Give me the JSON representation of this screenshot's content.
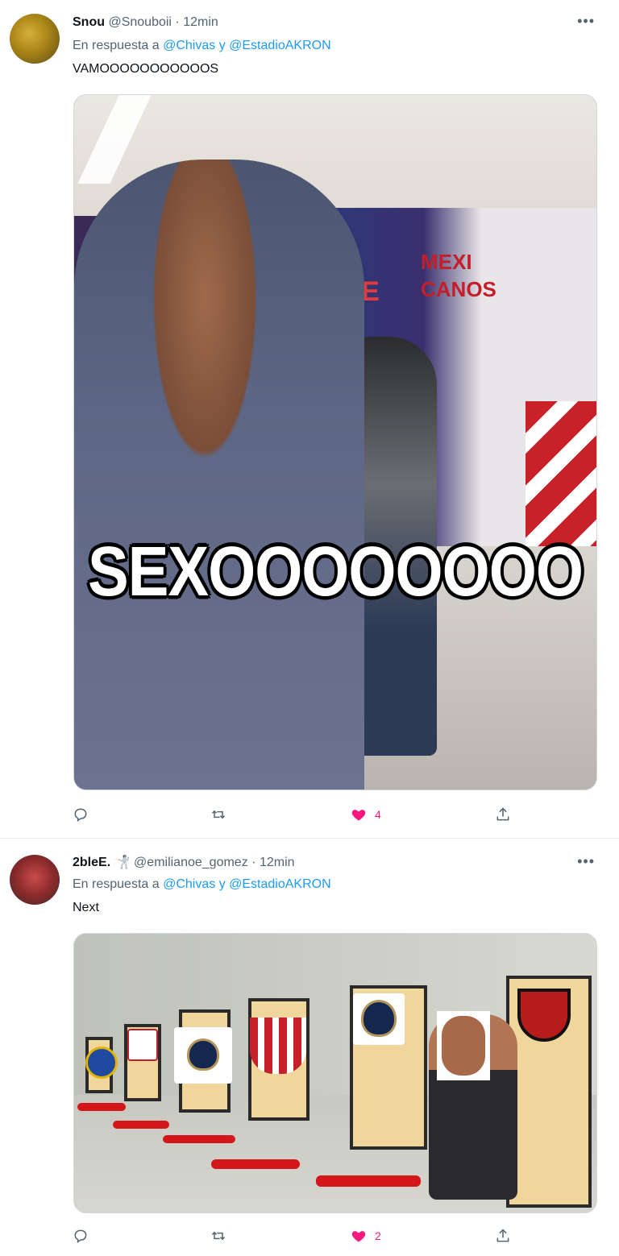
{
  "tweets": [
    {
      "display_name": "Snou",
      "handle": "@Snouboii",
      "separator": "·",
      "time": "12min",
      "reply_prefix": "En respuesta a",
      "reply_mention_1": "@Chivas",
      "reply_conj": "y",
      "reply_mention_2": "@EstadioAKRON",
      "text": "VAMOOOOOOOOOOOS",
      "more_icon": "more-icon",
      "media": {
        "caption": "SEXOOOOOOOO",
        "ad_text_1": "NCE",
        "ad_text_2_line1": "MEXI",
        "ad_text_2_line2": "CANOS"
      },
      "actions": {
        "reply_count": "",
        "retweet_count": "",
        "like_count": "4"
      }
    },
    {
      "display_name": "2bleE.",
      "handle": "@emilianoe_gomez",
      "separator": "·",
      "time": "12min",
      "badge_icon": "fencer-emoji-icon",
      "reply_prefix": "En respuesta a",
      "reply_mention_1": "@Chivas",
      "reply_conj": "y",
      "reply_mention_2": "@EstadioAKRON",
      "text": "Next",
      "more_icon": "more-icon",
      "actions": {
        "reply_count": "",
        "retweet_count": "",
        "like_count": "2"
      }
    }
  ],
  "colors": {
    "accent": "#1d9bf0",
    "like": "#f91880",
    "muted": "#536471",
    "text": "#0f1419"
  }
}
